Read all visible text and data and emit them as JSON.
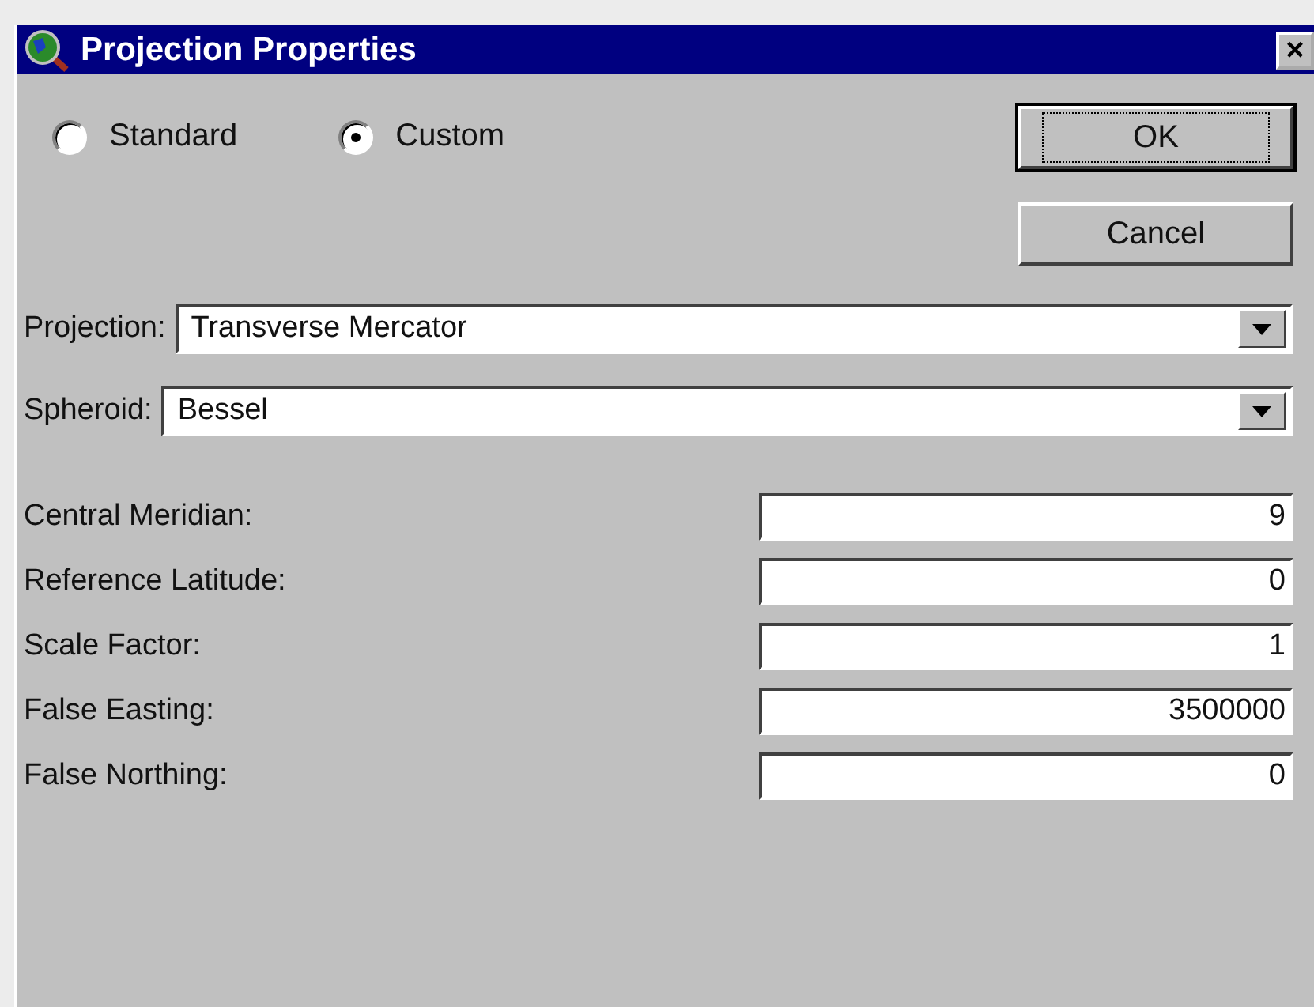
{
  "window": {
    "title": "Projection Properties",
    "close": "×"
  },
  "mode": [
    {
      "label": "Standard",
      "selected": false
    },
    {
      "label": "Custom",
      "selected": true
    }
  ],
  "buttons": [
    {
      "label": "OK",
      "default": true
    },
    {
      "label": "Cancel",
      "default": false
    }
  ],
  "selects": [
    {
      "label": "Projection:",
      "value": "Transverse Mercator"
    },
    {
      "label": "Spheroid:",
      "value": "Bessel"
    }
  ],
  "parameters": [
    {
      "label": "Central Meridian:",
      "value": "9"
    },
    {
      "label": "Reference Latitude:",
      "value": "0"
    },
    {
      "label": "Scale Factor:",
      "value": "1"
    },
    {
      "label": "False Easting:",
      "value": "3500000"
    },
    {
      "label": "False Northing:",
      "value": "0"
    }
  ]
}
